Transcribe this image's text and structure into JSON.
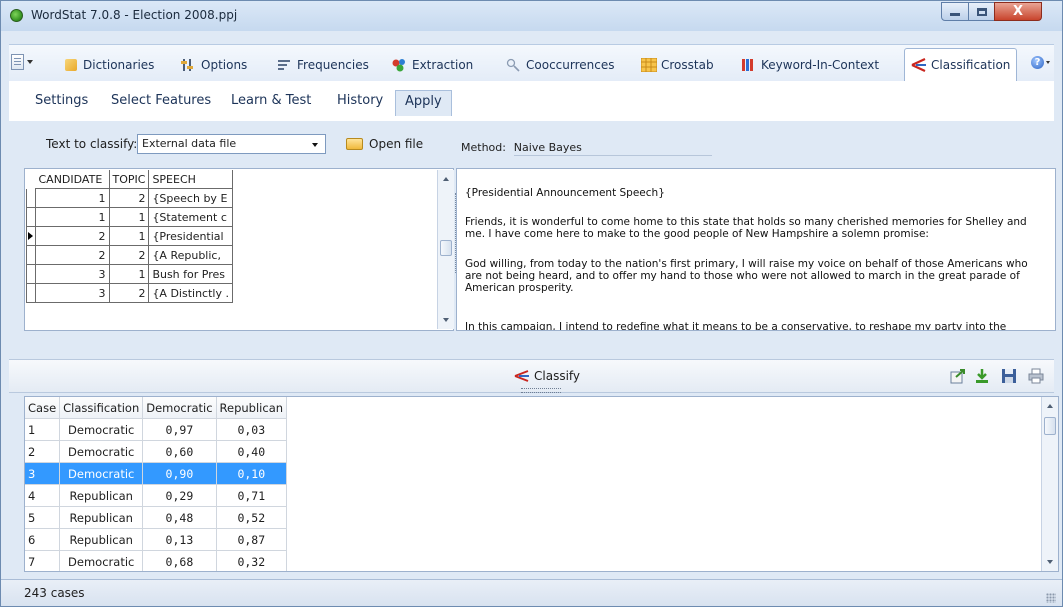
{
  "window": {
    "title": "WordStat 7.0.8 - Election 2008.ppj",
    "close_glyph": "X"
  },
  "ribbon": {
    "tabs": [
      {
        "label": "Dictionaries",
        "icon": "dictionary-icon"
      },
      {
        "label": "Options",
        "icon": "options-icon"
      },
      {
        "label": "Frequencies",
        "icon": "frequencies-icon"
      },
      {
        "label": "Extraction",
        "icon": "extraction-icon"
      },
      {
        "label": "Cooccurrences",
        "icon": "cooccurrences-icon"
      },
      {
        "label": "Crosstab",
        "icon": "crosstab-icon"
      },
      {
        "label": "Keyword-In-Context",
        "icon": "kwic-icon"
      },
      {
        "label": "Classification",
        "icon": "classification-icon",
        "active": true
      }
    ],
    "help_glyph": "?"
  },
  "subtabs": [
    "Settings",
    "Select Features",
    "Learn & Test",
    "History",
    "Apply"
  ],
  "apply": {
    "text_label": "Text to classify:",
    "text_source": "External data file",
    "open_file_label": "Open file",
    "method_label": "Method:",
    "method_value": "Naive Bayes"
  },
  "candidate_grid": {
    "columns": [
      "CANDIDATE",
      "TOPIC",
      "SPEECH"
    ],
    "rows": [
      [
        "1",
        "2",
        "{Speech by E"
      ],
      [
        "1",
        "1",
        "{Statement c"
      ],
      [
        "2",
        "1",
        "{Presidential"
      ],
      [
        "2",
        "2",
        "{A Republic,"
      ],
      [
        "3",
        "1",
        "Bush for Pres"
      ],
      [
        "3",
        "2",
        "{A Distinctly ."
      ]
    ],
    "current_row": 2
  },
  "speech": {
    "paragraphs": [
      "{Presidential Announcement Speech}",
      "Friends, it is wonderful to come home to this state that holds so many cherished memories for Shelley and me. I have come here to make to the good people of New Hampshire a solemn promise:",
      "God willing, from today to the nation's first primary, I will raise my voice on behalf of those Americans who are not being heard, and to offer my hand to those who were not allowed to march in the great parade of American prosperity.",
      "In this campaign, I intend to redefine what it means to be a conservative, to reshape my party into the"
    ]
  },
  "toolbar": {
    "classify_label": "Classify"
  },
  "results": {
    "columns": [
      "Case",
      "Classification",
      "Democratic",
      "Republican"
    ],
    "rows": [
      [
        "1",
        "Democratic",
        "0,97",
        "0,03"
      ],
      [
        "2",
        "Democratic",
        "0,60",
        "0,40"
      ],
      [
        "3",
        "Democratic",
        "0,90",
        "0,10"
      ],
      [
        "4",
        "Republican",
        "0,29",
        "0,71"
      ],
      [
        "5",
        "Republican",
        "0,48",
        "0,52"
      ],
      [
        "6",
        "Republican",
        "0,13",
        "0,87"
      ],
      [
        "7",
        "Democratic",
        "0,68",
        "0,32"
      ]
    ],
    "selected_row": 2
  },
  "status": {
    "text": "243 cases"
  },
  "colors": {
    "selection": "#3399ff",
    "accent": "#c9261f"
  }
}
